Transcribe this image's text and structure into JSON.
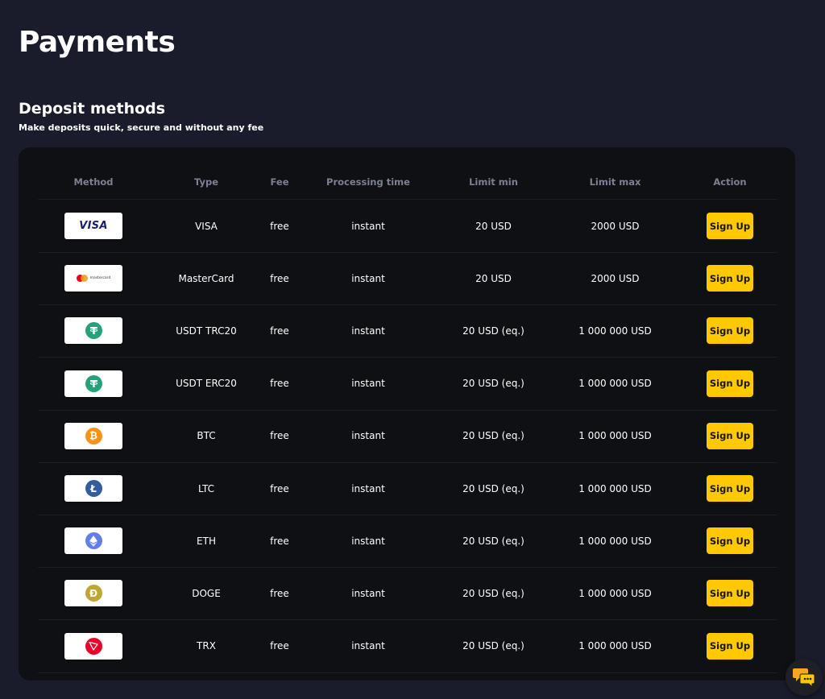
{
  "page": {
    "title": "Payments"
  },
  "section": {
    "title": "Deposit methods",
    "subtitle": "Make deposits quick, secure and without any fee"
  },
  "table": {
    "headers": {
      "method": "Method",
      "type": "Type",
      "fee": "Fee",
      "time": "Processing time",
      "min": "Limit min",
      "max": "Limit max",
      "action": "Action"
    },
    "rows": [
      {
        "logo": "visa-logo",
        "logo_text": "VISA",
        "type": "VISA",
        "fee": "free",
        "time": "instant",
        "min": "20 USD",
        "max": "2000 USD",
        "action": "Sign Up"
      },
      {
        "logo": "mastercard-logo",
        "logo_text": "mastercard",
        "type": "MasterCard",
        "fee": "free",
        "time": "instant",
        "min": "20 USD",
        "max": "2000 USD",
        "action": "Sign Up"
      },
      {
        "logo": "tether-icon",
        "logo_color": "#26a17b",
        "type": "USDT TRC20",
        "fee": "free",
        "time": "instant",
        "min": "20 USD (eq.)",
        "max": "1 000 000 USD",
        "action": "Sign Up"
      },
      {
        "logo": "tether-icon",
        "logo_color": "#26a17b",
        "type": "USDT ERC20",
        "fee": "free",
        "time": "instant",
        "min": "20 USD (eq.)",
        "max": "1 000 000 USD",
        "action": "Sign Up"
      },
      {
        "logo": "bitcoin-icon",
        "logo_color": "#f7931a",
        "type": "BTC",
        "fee": "free",
        "time": "instant",
        "min": "20 USD (eq.)",
        "max": "1 000 000 USD",
        "action": "Sign Up"
      },
      {
        "logo": "litecoin-icon",
        "logo_color": "#345d9d",
        "type": "LTC",
        "fee": "free",
        "time": "instant",
        "min": "20 USD (eq.)",
        "max": "1 000 000 USD",
        "action": "Sign Up"
      },
      {
        "logo": "ethereum-icon",
        "logo_color": "#627eea",
        "type": "ETH",
        "fee": "free",
        "time": "instant",
        "min": "20 USD (eq.)",
        "max": "1 000 000 USD",
        "action": "Sign Up"
      },
      {
        "logo": "dogecoin-icon",
        "logo_color": "#c2a633",
        "type": "DOGE",
        "fee": "free",
        "time": "instant",
        "min": "20 USD (eq.)",
        "max": "1 000 000 USD",
        "action": "Sign Up"
      },
      {
        "logo": "tron-icon",
        "logo_color": "#eb0029",
        "type": "TRX",
        "fee": "free",
        "time": "instant",
        "min": "20 USD (eq.)",
        "max": "1 000 000 USD",
        "action": "Sign Up"
      }
    ]
  },
  "chat": {
    "icon": "chat-bubbles-icon"
  },
  "colors": {
    "background": "#1b1c2b",
    "card": "#0e1014",
    "accent": "#ffc800",
    "header_text": "#7d8092"
  }
}
